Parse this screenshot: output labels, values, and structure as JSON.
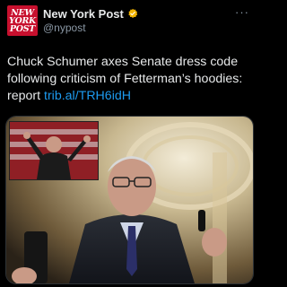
{
  "account": {
    "avatar_text": [
      "NEW",
      "YORK",
      "POST"
    ],
    "display_name": "New York Post",
    "handle": "@nypost",
    "verified_color": "#f2b400"
  },
  "more_menu": {
    "label": "···"
  },
  "tweet": {
    "text": "Chuck Schumer axes Senate dress code following criticism of Fetterman’s hoodies: report ",
    "link": "trib.al/TRH6idH"
  },
  "colors": {
    "background": "#000000",
    "text": "#e7e9ea",
    "secondary_text": "#8b98a5",
    "link": "#1d9bf0",
    "brand_red": "#c8102e"
  }
}
